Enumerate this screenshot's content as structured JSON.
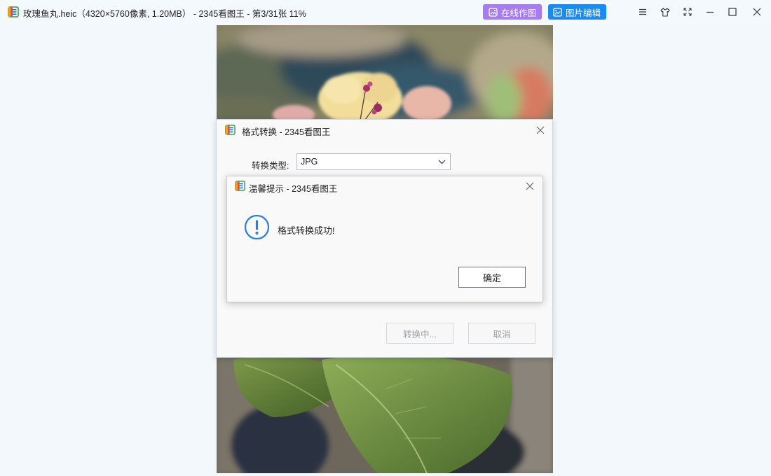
{
  "window": {
    "title": "玫瑰鱼丸.heic（4320×5760像素, 1.20MB） - 2345看图王 - 第3/31张 11%",
    "online_draw_label": "在线作图",
    "image_edit_label": "图片编辑",
    "controls": [
      "menu-icon",
      "skin-icon",
      "fullscreen-icon",
      "minimize-icon",
      "maximize-icon",
      "close-icon"
    ]
  },
  "format_dialog": {
    "title": "格式转换 - 2345看图王",
    "type_label": "转换类型:",
    "type_value": "JPG",
    "converting_label": "转换中...",
    "cancel_label": "取消"
  },
  "tip_dialog": {
    "title": "温馨提示 - 2345看图王",
    "message": "格式转换成功!",
    "ok_label": "确定"
  },
  "colors": {
    "accent_purple": "#a57df0",
    "accent_blue": "#1a8bf0",
    "info_icon": "#2b7de0"
  }
}
